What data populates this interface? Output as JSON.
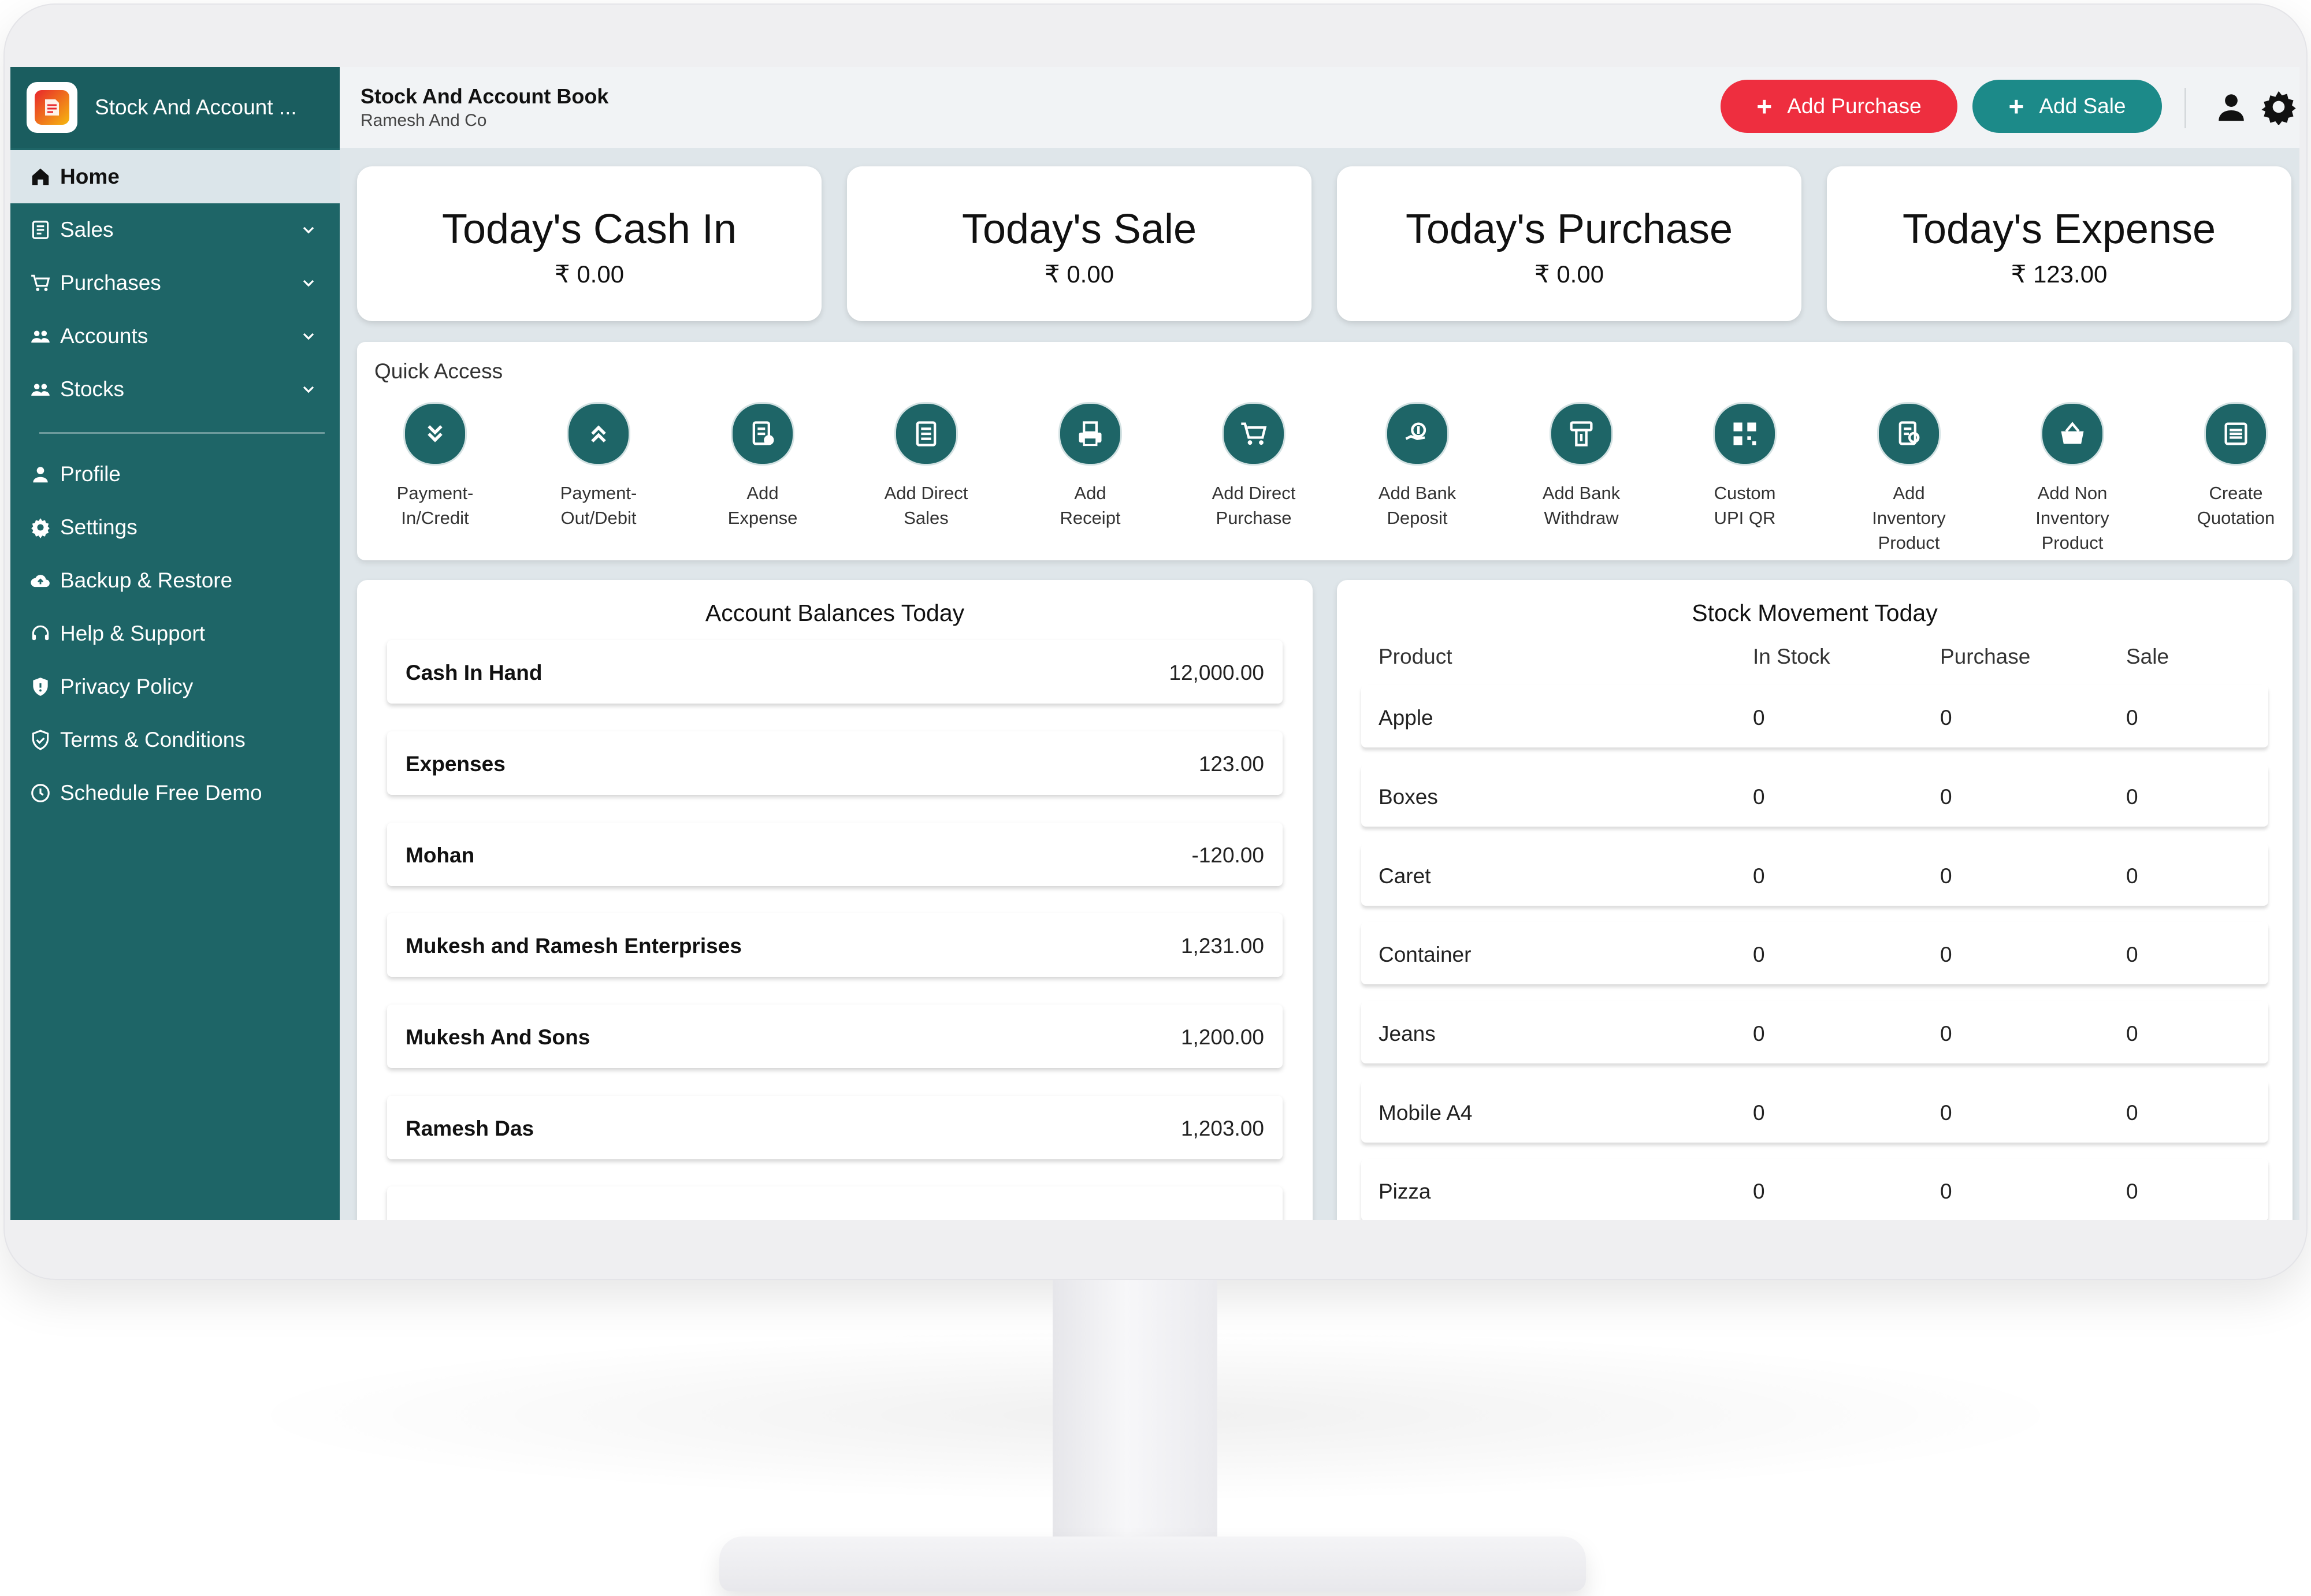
{
  "app": {
    "brand_name": "Stock And Account ...",
    "header_title": "Stock And Account Book",
    "header_subtitle": "Ramesh And Co"
  },
  "header": {
    "add_purchase_label": "Add Purchase",
    "add_sale_label": "Add Sale",
    "add_purchase_color": "#ee2e3f",
    "add_sale_color": "#1c8a89"
  },
  "sidebar": {
    "accent_color": "#1e6567",
    "items": [
      {
        "label": "Home",
        "icon": "home-icon"
      },
      {
        "label": "Sales",
        "icon": "sales-icon"
      },
      {
        "label": "Purchases",
        "icon": "cart-icon"
      },
      {
        "label": "Accounts",
        "icon": "accounts-icon"
      },
      {
        "label": "Stocks",
        "icon": "stocks-icon"
      },
      {
        "label": "Profile",
        "icon": "profile-icon"
      },
      {
        "label": "Settings",
        "icon": "gear-icon"
      },
      {
        "label": "Backup & Restore",
        "icon": "cloud-icon"
      },
      {
        "label": "Help & Support",
        "icon": "support-icon"
      },
      {
        "label": "Privacy Policy",
        "icon": "shield-icon"
      },
      {
        "label": "Terms & Conditions",
        "icon": "shield-check-icon"
      },
      {
        "label": "Schedule Free Demo",
        "icon": "clock-icon"
      }
    ]
  },
  "summary": [
    {
      "title": "Today's Cash In",
      "value": "₹ 0.00"
    },
    {
      "title": "Today's Sale",
      "value": "₹ 0.00"
    },
    {
      "title": "Today's Purchase",
      "value": "₹ 0.00"
    },
    {
      "title": "Today's Expense",
      "value": "₹ 123.00"
    }
  ],
  "quick_access": {
    "title": "Quick Access",
    "items": [
      {
        "line1": "Payment-",
        "line2": "In/Credit",
        "line3": ""
      },
      {
        "line1": "Payment-",
        "line2": "Out/Debit",
        "line3": ""
      },
      {
        "line1": "Add",
        "line2": "Expense",
        "line3": ""
      },
      {
        "line1": "Add Direct",
        "line2": "Sales",
        "line3": ""
      },
      {
        "line1": "Add",
        "line2": "Receipt",
        "line3": ""
      },
      {
        "line1": "Add Direct",
        "line2": "Purchase",
        "line3": ""
      },
      {
        "line1": "Add Bank",
        "line2": "Deposit",
        "line3": ""
      },
      {
        "line1": "Add Bank",
        "line2": "Withdraw",
        "line3": ""
      },
      {
        "line1": "Custom",
        "line2": "UPI QR",
        "line3": ""
      },
      {
        "line1": "Add",
        "line2": "Inventory",
        "line3": "Product"
      },
      {
        "line1": "Add Non",
        "line2": "Inventory",
        "line3": "Product"
      },
      {
        "line1": "Create",
        "line2": "Quotation",
        "line3": ""
      }
    ]
  },
  "account_balances": {
    "title": "Account Balances Today",
    "rows": [
      {
        "name": "Cash In Hand",
        "value": "12,000.00"
      },
      {
        "name": "Expenses",
        "value": "123.00"
      },
      {
        "name": "Mohan",
        "value": "-120.00"
      },
      {
        "name": "Mukesh and Ramesh Enterprises",
        "value": "1,231.00"
      },
      {
        "name": "Mukesh And Sons",
        "value": "1,200.00"
      },
      {
        "name": "Ramesh Das",
        "value": "1,203.00"
      }
    ]
  },
  "stock_movement": {
    "title": "Stock Movement Today",
    "columns": [
      "Product",
      "In Stock",
      "Purchase",
      "Sale"
    ],
    "rows": [
      {
        "product": "Apple",
        "in_stock": "0",
        "purchase": "0",
        "sale": "0"
      },
      {
        "product": "Boxes",
        "in_stock": "0",
        "purchase": "0",
        "sale": "0"
      },
      {
        "product": "Caret",
        "in_stock": "0",
        "purchase": "0",
        "sale": "0"
      },
      {
        "product": "Container",
        "in_stock": "0",
        "purchase": "0",
        "sale": "0"
      },
      {
        "product": "Jeans",
        "in_stock": "0",
        "purchase": "0",
        "sale": "0"
      },
      {
        "product": "Mobile A4",
        "in_stock": "0",
        "purchase": "0",
        "sale": "0"
      },
      {
        "product": "Pizza",
        "in_stock": "0",
        "purchase": "0",
        "sale": "0"
      }
    ]
  }
}
